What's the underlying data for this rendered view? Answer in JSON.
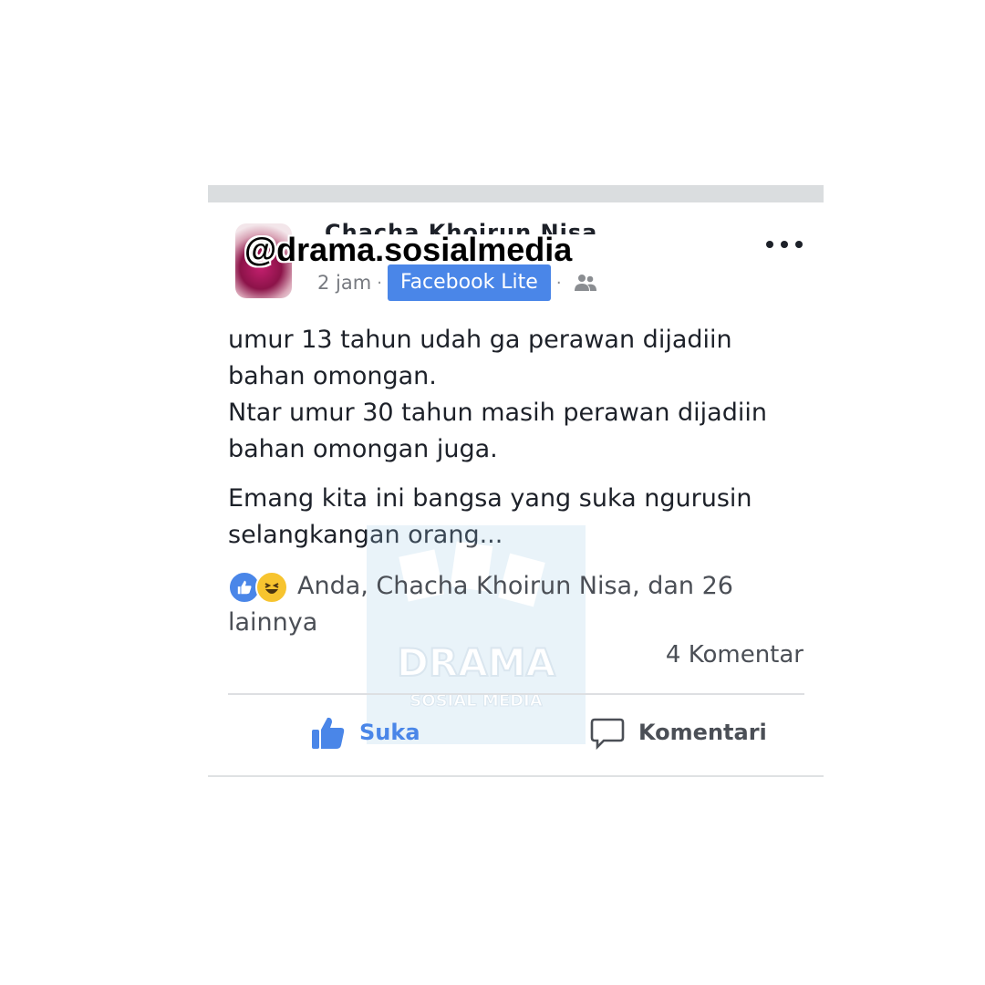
{
  "watermark": {
    "handle": "@drama.sosialmedia",
    "logo_text": "DRAMA",
    "logo_subtext": "SOSIAL MEDIA"
  },
  "post": {
    "author_name_partial": "Chacha Khoirun Nisa",
    "time": "2 jam",
    "separator": "·",
    "app_badge": "Facebook Lite",
    "privacy_icon": "friends-icon",
    "text": [
      "umur 13 tahun udah ga perawan dijadiin bahan omongan.\nNtar umur 30 tahun masih perawan dijadiin bahan omongan juga.",
      "Emang kita ini bangsa yang suka ngurusin selangkangan orang..."
    ],
    "reactions_text": "Anda, Chacha Khoirun Nisa, dan 26 lainnya",
    "comment_count": "4 Komentar"
  },
  "actions": {
    "like_label": "Suka",
    "comment_label": "Komentari"
  },
  "colors": {
    "accent": "#4a86e8",
    "text": "#1d2129",
    "muted": "#777a80",
    "topbar": "#dadddf"
  }
}
